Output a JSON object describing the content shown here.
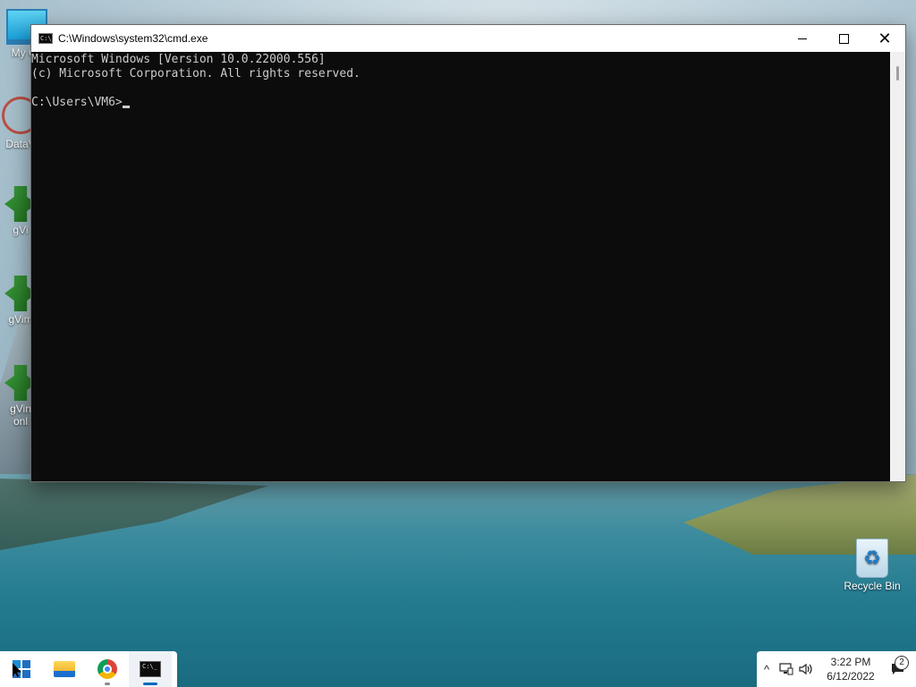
{
  "window": {
    "title": "C:\\Windows\\system32\\cmd.exe",
    "console_lines": [
      "Microsoft Windows [Version 10.0.22000.556]",
      "(c) Microsoft Corporation. All rights reserved.",
      "",
      "C:\\Users\\VM6>"
    ],
    "controls": {
      "minimize": "minimize-icon",
      "maximize": "maximize-icon",
      "close": "✕"
    }
  },
  "desktop": {
    "icons": [
      {
        "label": "My Co",
        "icon": "monitor-icon"
      },
      {
        "label": "DataV",
        "icon": "atom-icon"
      },
      {
        "label": "gVi",
        "icon": "vim-icon"
      },
      {
        "label": "gVim",
        "icon": "vim-icon"
      },
      {
        "label": "gVin\nonl",
        "icon": "vim-icon"
      },
      {
        "label": "Recycle Bin",
        "icon": "recycle-bin-icon"
      }
    ]
  },
  "taskbar": {
    "apps": [
      {
        "name": "Start",
        "icon": "windows-start-icon"
      },
      {
        "name": "File Explorer",
        "icon": "folder-icon"
      },
      {
        "name": "Google Chrome",
        "icon": "chrome-icon"
      },
      {
        "name": "Command Prompt",
        "icon": "cmd-icon"
      }
    ],
    "tray": {
      "chevron": "^",
      "network_icon": "network-icon",
      "volume_icon": "volume-icon",
      "time": "3:22 PM",
      "date": "6/12/2022",
      "notification_count": "2"
    }
  }
}
